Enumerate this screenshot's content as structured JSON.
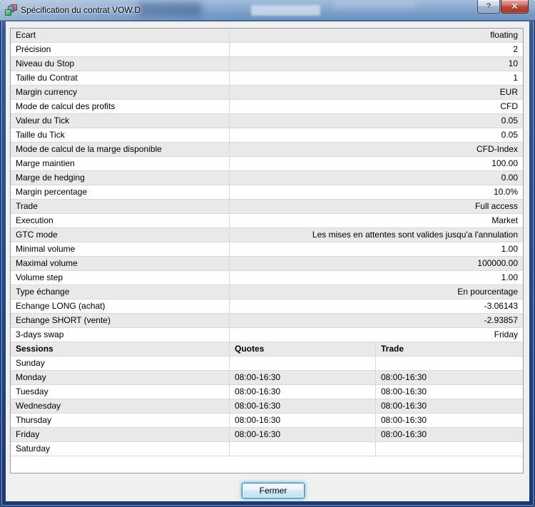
{
  "window": {
    "title": "Spécification du contrat VOW.D",
    "help_glyph": "?",
    "close_glyph": "✕"
  },
  "properties": [
    {
      "label": "Ecart",
      "value": "floating"
    },
    {
      "label": "Précision",
      "value": "2"
    },
    {
      "label": "Niveau du Stop",
      "value": "10"
    },
    {
      "label": "Taille du Contrat",
      "value": "1"
    },
    {
      "label": "Margin currency",
      "value": "EUR"
    },
    {
      "label": "Mode de calcul des profits",
      "value": "CFD"
    },
    {
      "label": "Valeur du Tick",
      "value": "0.05"
    },
    {
      "label": "Taille du Tick",
      "value": "0.05"
    },
    {
      "label": "Mode de calcul de la marge disponible",
      "value": "CFD-Index"
    },
    {
      "label": "Marge maintien",
      "value": "100.00"
    },
    {
      "label": "Marge de hedging",
      "value": "0.00"
    },
    {
      "label": "Margin percentage",
      "value": "10.0%"
    },
    {
      "label": "Trade",
      "value": "Full access"
    },
    {
      "label": "Execution",
      "value": "Market"
    },
    {
      "label": "GTC mode",
      "value": "Les mises en attentes sont valides jusqu'a l'annulation"
    },
    {
      "label": "Minimal volume",
      "value": "1.00"
    },
    {
      "label": "Maximal volume",
      "value": "100000.00"
    },
    {
      "label": "Volume step",
      "value": "1.00"
    },
    {
      "label": "Type échange",
      "value": "En pourcentage"
    },
    {
      "label": "Echange LONG (achat)",
      "value": "-3.06143"
    },
    {
      "label": "Echange SHORT (vente)",
      "value": "-2.93857"
    },
    {
      "label": "3-days swap",
      "value": "Friday"
    }
  ],
  "sessions": {
    "headers": {
      "sessions": "Sessions",
      "quotes": "Quotes",
      "trade": "Trade"
    },
    "rows": [
      {
        "day": "Sunday",
        "quotes": "",
        "trade": ""
      },
      {
        "day": "Monday",
        "quotes": "08:00-16:30",
        "trade": "08:00-16:30"
      },
      {
        "day": "Tuesday",
        "quotes": "08:00-16:30",
        "trade": "08:00-16:30"
      },
      {
        "day": "Wednesday",
        "quotes": "08:00-16:30",
        "trade": "08:00-16:30"
      },
      {
        "day": "Thursday",
        "quotes": "08:00-16:30",
        "trade": "08:00-16:30"
      },
      {
        "day": "Friday",
        "quotes": "08:00-16:30",
        "trade": "08:00-16:30"
      },
      {
        "day": "Saturday",
        "quotes": "",
        "trade": ""
      }
    ]
  },
  "footer": {
    "close_button_label": "Fermer"
  },
  "colors": {
    "titlebar_blue": "#7d9fca",
    "window_border_navy": "#24478a",
    "row_alt_gray": "#e9e9e9",
    "button_glow_cyan": "#46b4e8",
    "close_button_red": "#bc4a3e"
  }
}
